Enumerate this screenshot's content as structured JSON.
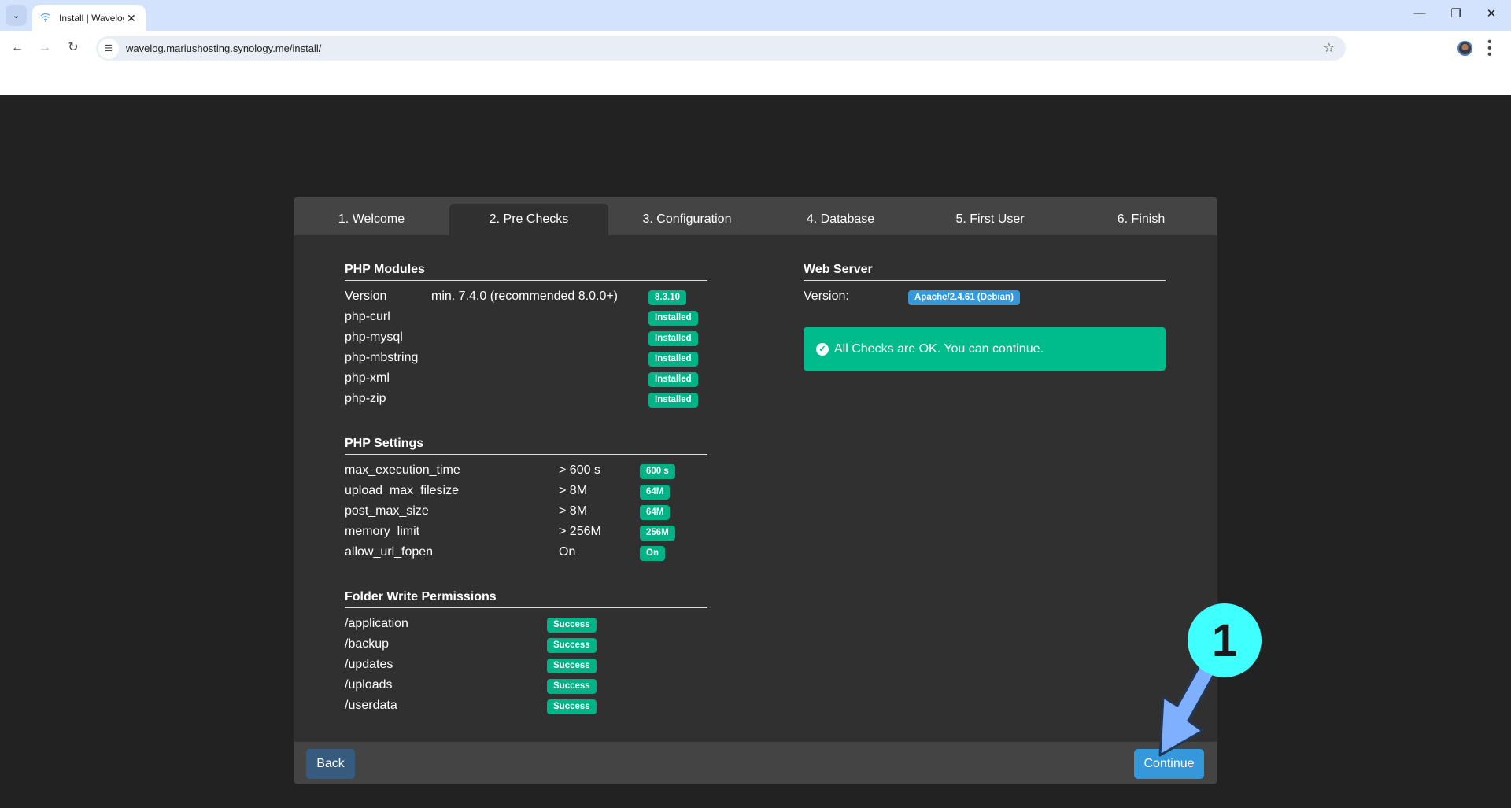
{
  "browser": {
    "tab_title": "Install | Wavelog",
    "url": "wavelog.mariushosting.synology.me/install/",
    "icons": {
      "tab_dropdown": "chevron-down-icon",
      "favicon": "wifi-icon",
      "close": "close-icon",
      "back": "arrow-left-icon",
      "forward": "arrow-right-icon",
      "reload": "reload-icon",
      "site_info": "tune-icon",
      "bookmark": "star-icon",
      "menu": "more-vertical-icon"
    }
  },
  "installer": {
    "steps": [
      {
        "label": "1. Welcome",
        "active": false
      },
      {
        "label": "2. Pre Checks",
        "active": true
      },
      {
        "label": "3. Configuration",
        "active": false
      },
      {
        "label": "4. Database",
        "active": false
      },
      {
        "label": "5. First User",
        "active": false
      },
      {
        "label": "6. Finish",
        "active": false
      }
    ],
    "php_modules": {
      "title": "PHP Modules",
      "version": {
        "label": "Version",
        "requirement": "min. 7.4.0 (recommended 8.0.0+)",
        "value": "8.3.10"
      },
      "modules": [
        {
          "name": "php-curl",
          "status": "Installed"
        },
        {
          "name": "php-mysql",
          "status": "Installed"
        },
        {
          "name": "php-mbstring",
          "status": "Installed"
        },
        {
          "name": "php-xml",
          "status": "Installed"
        },
        {
          "name": "php-zip",
          "status": "Installed"
        }
      ]
    },
    "php_settings": {
      "title": "PHP Settings",
      "rows": [
        {
          "name": "max_execution_time",
          "requirement": "> 600 s",
          "value": "600 s"
        },
        {
          "name": "upload_max_filesize",
          "requirement": "> 8M",
          "value": "64M"
        },
        {
          "name": "post_max_size",
          "requirement": "> 8M",
          "value": "64M"
        },
        {
          "name": "memory_limit",
          "requirement": "> 256M",
          "value": "256M"
        },
        {
          "name": "allow_url_fopen",
          "requirement": "On",
          "value": "On"
        }
      ]
    },
    "folder_permissions": {
      "title": "Folder Write Permissions",
      "rows": [
        {
          "path": "/application",
          "status": "Success"
        },
        {
          "path": "/backup",
          "status": "Success"
        },
        {
          "path": "/updates",
          "status": "Success"
        },
        {
          "path": "/uploads",
          "status": "Success"
        },
        {
          "path": "/userdata",
          "status": "Success"
        }
      ]
    },
    "web_server": {
      "title": "Web Server",
      "version_label": "Version:",
      "version_value": "Apache/2.4.61 (Debian)"
    },
    "alert": {
      "icon": "check-circle-icon",
      "message": "All Checks are OK. You can continue."
    },
    "buttons": {
      "back": "Back",
      "continue": "Continue"
    }
  },
  "annotation": {
    "step_number": "1",
    "circle_color": "#40ffff",
    "arrow_color": "#7fb0ff"
  },
  "colors": {
    "success": "#00bc8c",
    "info": "#3498db",
    "primary_dark": "#375a7f"
  }
}
